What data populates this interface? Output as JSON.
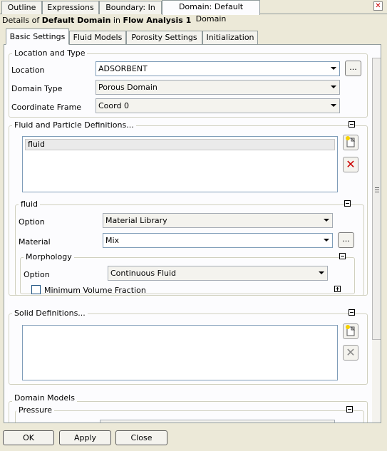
{
  "top_tabs": [
    {
      "label": "Outline"
    },
    {
      "label": "Expressions"
    },
    {
      "label": "Boundary: In"
    },
    {
      "label": "Domain: Default Domain"
    }
  ],
  "details": {
    "prefix": "Details of ",
    "object": "Default Domain",
    "middle": " in ",
    "analysis": "Flow Analysis 1"
  },
  "inner_tabs": [
    {
      "label": "Basic Settings"
    },
    {
      "label": "Fluid Models"
    },
    {
      "label": "Porosity Settings"
    },
    {
      "label": "Initialization"
    }
  ],
  "location_type": {
    "title": "Location and Type",
    "location_label": "Location",
    "location_value": "ADSORBENT",
    "more_button": "...",
    "domain_type_label": "Domain Type",
    "domain_type_value": "Porous Domain",
    "coord_label": "Coordinate Frame",
    "coord_value": "Coord 0"
  },
  "fluid_particle": {
    "title": "Fluid and Particle Definitions...",
    "items": [
      "fluid"
    ]
  },
  "fluid": {
    "title": "fluid",
    "option_label": "Option",
    "option_value": "Material Library",
    "material_label": "Material",
    "material_value": "Mix",
    "more_button": "...",
    "morphology": {
      "title": "Morphology",
      "option_label": "Option",
      "option_value": "Continuous Fluid",
      "min_volume_label": "Minimum Volume Fraction"
    }
  },
  "solid": {
    "title": "Solid Definitions..."
  },
  "domain_models": {
    "title": "Domain Models",
    "pressure_title": "Pressure"
  },
  "buttons": {
    "ok": "OK",
    "apply": "Apply",
    "close": "Close"
  }
}
